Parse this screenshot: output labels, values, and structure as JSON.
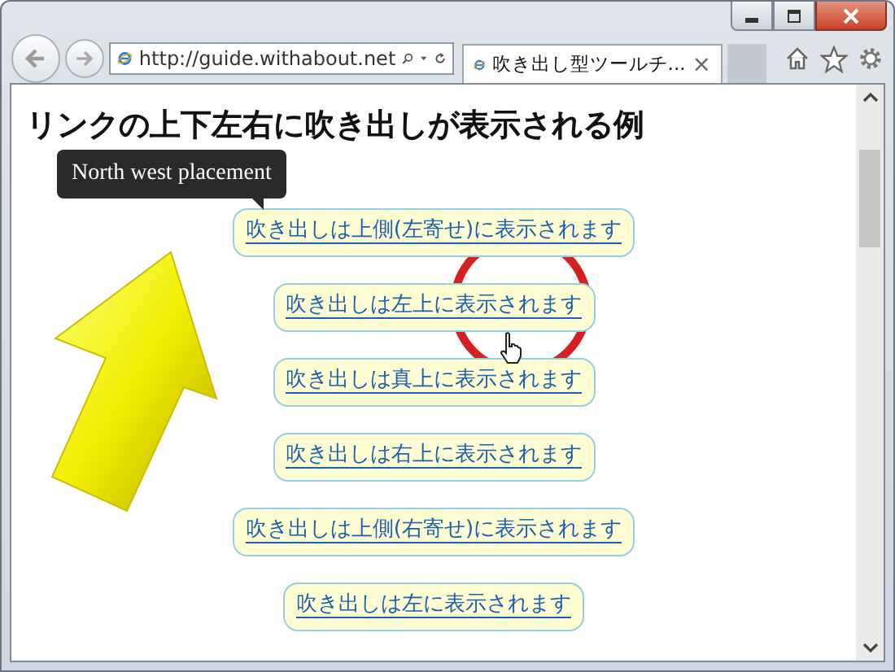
{
  "browser": {
    "address": "http://guide.withabout.net",
    "tabs": [
      {
        "title": "吹き出し型ツールチ...",
        "close": "×",
        "selected": true
      }
    ]
  },
  "page": {
    "heading": "リンクの上下左右に吹き出しが表示される例",
    "tooltip": {
      "text": "North west placement"
    },
    "links": [
      {
        "text": "吹き出しは上側(左寄せ)に表示されます"
      },
      {
        "text": "吹き出しは左上に表示されます"
      },
      {
        "text": "吹き出しは真上に表示されます"
      },
      {
        "text": "吹き出しは右上に表示されます"
      },
      {
        "text": "吹き出しは上側(右寄せ)に表示されます"
      },
      {
        "text": "吹き出しは左に表示されます"
      }
    ]
  }
}
